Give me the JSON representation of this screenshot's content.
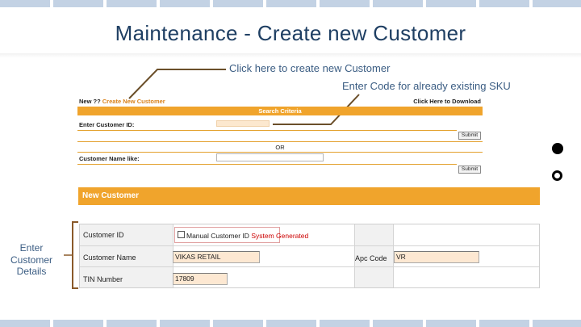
{
  "slide": {
    "title": "Maintenance - Create new Customer",
    "annotations": {
      "create_new": "Click here to create new Customer",
      "enter_code": "Enter Code for already  existing SKU",
      "side_label": [
        "Enter",
        "Customer",
        "Details"
      ]
    }
  },
  "search_panel": {
    "new_prefix": "New ?? ",
    "new_link": "Create New Customer",
    "download_link": "Click Here to Download",
    "header": "Search Criteria",
    "customer_id_label": "Enter Customer ID:",
    "or_label": "OR",
    "customer_name_label": "Customer Name like:",
    "submit_label": "Submit"
  },
  "new_customer": {
    "header": "New Customer",
    "customer_id_label": "Customer ID",
    "manual_label": "Manual Customer ID",
    "system_generated": "System Generated",
    "manual_checked": false,
    "customer_name_label": "Customer Name",
    "customer_name_value": "VIKAS RETAIL",
    "apc_code_label": "Apc Code",
    "apc_code_value": "VR",
    "tin_label": "TIN Number",
    "tin_value": "17809"
  },
  "colors": {
    "title": "#1f3f63",
    "annotation": "#3b5d83",
    "orange_bar": "#f0a42c",
    "connector": "#6b4f2a",
    "bracket": "#8a5a2a"
  }
}
